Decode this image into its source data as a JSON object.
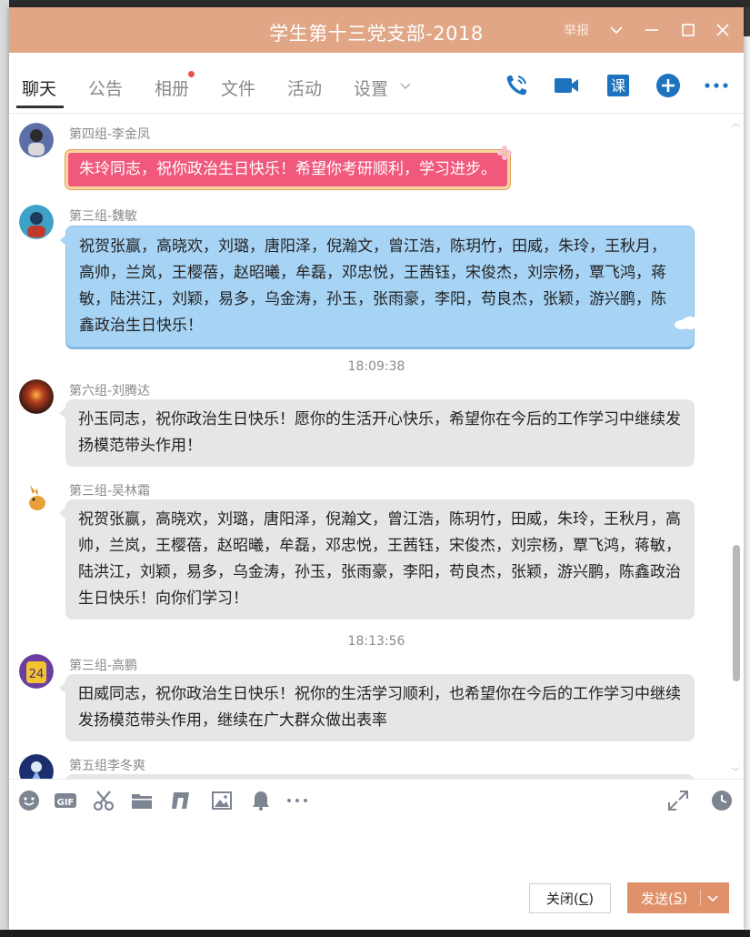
{
  "window": {
    "title": "学生第十三党支部-2018",
    "report_label": "举报"
  },
  "tabs": [
    {
      "label": "聊天",
      "active": true
    },
    {
      "label": "公告"
    },
    {
      "label": "相册",
      "has_badge": true
    },
    {
      "label": "文件"
    },
    {
      "label": "活动"
    },
    {
      "label": "设置"
    }
  ],
  "header_icons": [
    "phone-call-icon",
    "video-call-icon",
    "lesson-icon",
    "add-circle-icon",
    "more-icon"
  ],
  "messages": [
    {
      "sender": "第四组-李金凤",
      "text": "朱玲同志，祝你政治生日快乐！希望你考研顺利，学习进步。",
      "style": "pink"
    },
    {
      "sender": "第三组-魏敏",
      "text": "祝贺张赢，高晓欢，刘璐，唐阳泽，倪瀚文，曾江浩，陈玥竹，田威，朱玲，王秋月，高帅，兰岚，王樱蓓，赵昭曦，牟磊，邓忠悦，王茜钰，宋俊杰，刘宗杨，覃飞鸿，蒋敏，陆洪江，刘颖，易多，乌金涛，孙玉，张雨豪，李阳，苟良杰，张颖，游兴鹏，陈鑫政治生日快乐！",
      "style": "blue"
    },
    {
      "timestamp": "18:09:38"
    },
    {
      "sender": "第六组-刘腾达",
      "text": "孙玉同志，祝你政治生日快乐！愿你的生活开心快乐，希望你在今后的工作学习中继续发扬模范带头作用！",
      "style": "gray"
    },
    {
      "sender": "第三组-吴林霜",
      "text": "祝贺张赢，高晓欢，刘璐，唐阳泽，倪瀚文，曾江浩，陈玥竹，田威，朱玲，王秋月，高帅，兰岚，王樱蓓，赵昭曦，牟磊，邓忠悦，王茜钰，宋俊杰，刘宗杨，覃飞鸿，蒋敏，陆洪江，刘颖，易多，乌金涛，孙玉，张雨豪，李阳，苟良杰，张颖，游兴鹏，陈鑫政治生日快乐！向你们学习！",
      "style": "gray"
    },
    {
      "timestamp": "18:13:56"
    },
    {
      "sender": "第三组-高鹏",
      "text": "田威同志，祝你政治生日快乐！祝你的生活学习顺利，也希望你在今后的工作学习中继续发扬模范带头作用，继续在广大群众做出表率",
      "style": "gray"
    },
    {
      "sender": "第五组李冬爽",
      "text": "",
      "style": "gray"
    }
  ],
  "toolbar_icons": [
    "emoji-icon",
    "gif-icon",
    "screenshot-scissors-icon",
    "folder-icon",
    "music-icon",
    "image-icon",
    "bell-icon",
    "more-tools-icon",
    "expand-icon",
    "history-clock-icon"
  ],
  "buttons": {
    "close": {
      "label": "关闭(",
      "hotkey": "C",
      "suffix": ")"
    },
    "send": {
      "label": "发送(",
      "hotkey": "S",
      "suffix": ")"
    }
  },
  "colors": {
    "titlebar": "#e0a685",
    "accent_blue": "#1e73be",
    "send_button": "#e0916a",
    "bubble_gray": "#e6e6e6",
    "bubble_blue": "#a7d3f5",
    "bubble_pink": "#f0587c"
  }
}
